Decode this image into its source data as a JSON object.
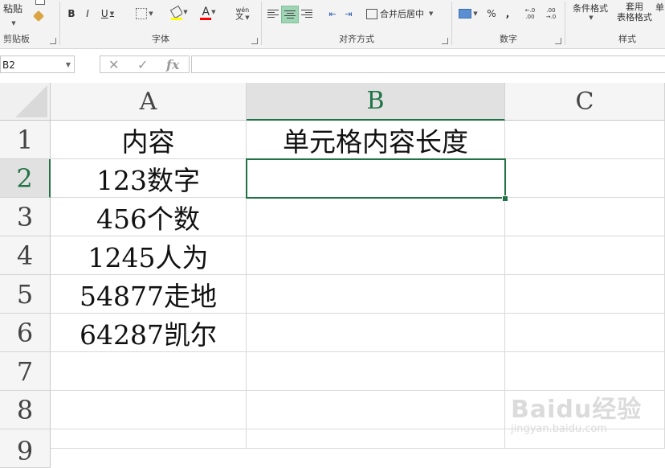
{
  "ribbon": {
    "clipboard": {
      "paste_label": "粘贴",
      "group_label": "剪贴板"
    },
    "font": {
      "bold": "B",
      "italic": "I",
      "underline": "U",
      "font_color_letter": "A",
      "phonetic_label": "wén",
      "group_label": "字体",
      "highlight_color": "#ffff00",
      "font_color": "#ff0000"
    },
    "alignment": {
      "merge_center_label": "合并后居中",
      "group_label": "对齐方式"
    },
    "number": {
      "percent": "%",
      "comma": ",",
      "inc_decimal": "←.0 .00",
      "dec_decimal": ".00 →.0",
      "group_label": "数字"
    },
    "styles": {
      "conditional_format_label": "条件格式",
      "table_format_label_1": "套用",
      "table_format_label_2": "表格格式",
      "cell_style_label": "单",
      "group_label": "样式"
    }
  },
  "formula_bar": {
    "name_box": "B2",
    "cancel_icon": "✕",
    "enter_icon": "✓",
    "fx": "fx",
    "formula": ""
  },
  "sheet": {
    "columns": [
      "A",
      "B",
      "C"
    ],
    "rows": [
      "1",
      "2",
      "3",
      "4",
      "5",
      "6",
      "7",
      "8",
      "9"
    ],
    "cells": {
      "A1": "内容",
      "B1": "单元格内容长度",
      "A2": "123数字",
      "A3": "456个数",
      "A4": "1245人为",
      "A5": "54877走地",
      "A6": "64287凯尔"
    },
    "active_cell": "B2",
    "accent_color": "#217346"
  },
  "watermark": {
    "main": "Baidu经验",
    "sub": "jingyan.baidu.com"
  }
}
